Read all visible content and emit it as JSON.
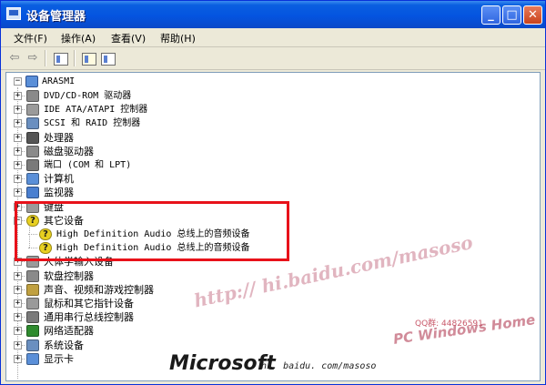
{
  "window": {
    "title": "设备管理器",
    "minimize": "_",
    "maximize": "□",
    "close": "✕"
  },
  "menu": [
    "文件(F)",
    "操作(A)",
    "查看(V)",
    "帮助(H)"
  ],
  "toolbar": {
    "back": "⇦",
    "forward": "⇨"
  },
  "tree": {
    "root": "ARASMI",
    "items": [
      {
        "label": "DVD/CD-ROM 驱动器",
        "icon": "dvd-drive-icon",
        "color": "#8a8a8a"
      },
      {
        "label": "IDE ATA/ATAPI 控制器",
        "icon": "ide-controller-icon",
        "color": "#9a9a9a"
      },
      {
        "label": "SCSI 和 RAID 控制器",
        "icon": "scsi-controller-icon",
        "color": "#6a8fc0"
      },
      {
        "label": "处理器",
        "icon": "processor-icon",
        "color": "#555555"
      },
      {
        "label": "磁盘驱动器",
        "icon": "disk-drive-icon",
        "color": "#8a8a8a"
      },
      {
        "label": "端口 (COM 和 LPT)",
        "icon": "port-icon",
        "color": "#7a7a7a"
      },
      {
        "label": "计算机",
        "icon": "computer-icon",
        "color": "#5a8fd8"
      },
      {
        "label": "监视器",
        "icon": "monitor-icon",
        "color": "#4a7fd0"
      },
      {
        "label": "键盘",
        "icon": "keyboard-icon",
        "color": "#9a9a9a"
      },
      {
        "label": "其它设备",
        "icon": "unknown-device-icon",
        "color": "#e8d020"
      },
      {
        "label": "High Definition Audio 总线上的音频设备",
        "icon": "unknown-device-icon",
        "color": "#e8d020"
      },
      {
        "label": "High Definition Audio 总线上的音频设备",
        "icon": "unknown-device-icon",
        "color": "#e8d020"
      },
      {
        "label": "人体学输入设备",
        "icon": "hid-icon",
        "color": "#9a9a9a"
      },
      {
        "label": "软盘控制器",
        "icon": "floppy-controller-icon",
        "color": "#8a8a8a"
      },
      {
        "label": "声音、视频和游戏控制器",
        "icon": "sound-icon",
        "color": "#c0a040"
      },
      {
        "label": "鼠标和其它指针设备",
        "icon": "mouse-icon",
        "color": "#9a9a9a"
      },
      {
        "label": "通用串行总线控制器",
        "icon": "usb-icon",
        "color": "#7a7a7a"
      },
      {
        "label": "网络适配器",
        "icon": "network-adapter-icon",
        "color": "#2e8b2e"
      },
      {
        "label": "系统设备",
        "icon": "system-device-icon",
        "color": "#6a8fc0"
      },
      {
        "label": "显示卡",
        "icon": "display-adapter-icon",
        "color": "#5a8fd8"
      }
    ]
  },
  "watermark": {
    "url_text": "http:// hi.baidu.com/masoso",
    "qq_text": "QQ群: 44826591",
    "brand_text": "PC Windows Home",
    "ms_logo": "Microsoft",
    "ms_url": "hi. baidu. com/masoso"
  }
}
